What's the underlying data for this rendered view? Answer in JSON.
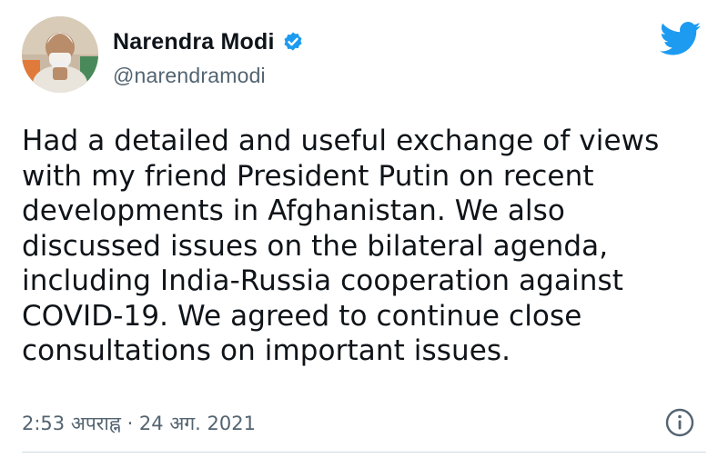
{
  "author": {
    "name": "Narendra Modi",
    "handle": "@narendramodi",
    "verified": true
  },
  "tweet": {
    "text": "Had a detailed and useful exchange of views\nwith my friend President Putin on recent\ndevelopments in Afghanistan. We also\ndiscussed issues on the bilateral agenda,\nincluding India-Russia cooperation against\nCOVID-19. We agreed to continue close\nconsultations on important issues.",
    "timestamp": "2:53 अपराह्न · 24 अग. 2021"
  },
  "icons": {
    "verified": "verified-badge-icon",
    "brand": "twitter-bird-icon",
    "info": "info-icon"
  },
  "colors": {
    "brand_blue": "#1d9bf0",
    "text": "#0f1419",
    "secondary_text": "#536471"
  }
}
